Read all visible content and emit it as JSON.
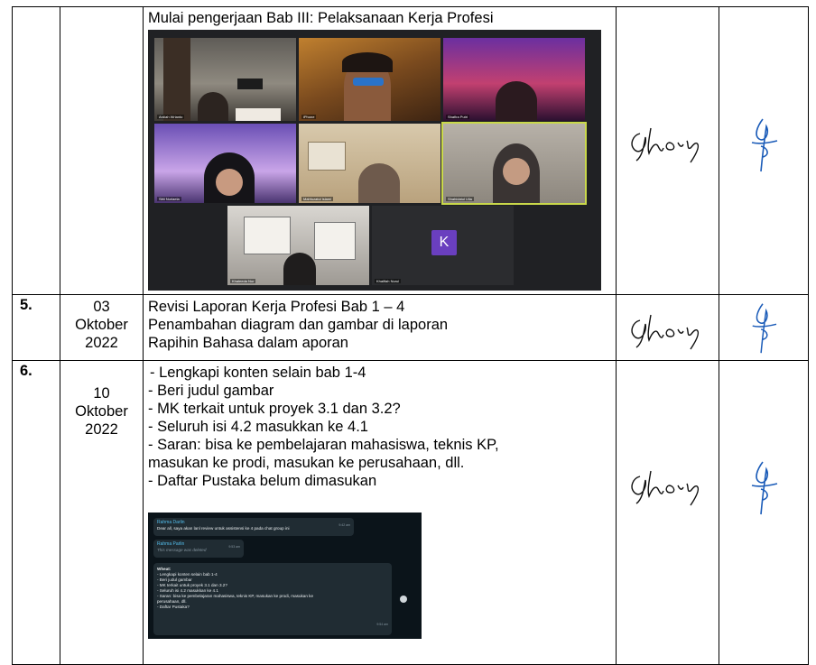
{
  "row4": {
    "activity": "Mulai pengerjaan Bab III: Pelaksanaan Kerja Profesi",
    "meeting": {
      "participants": [
        "Ardiah Wrianto",
        "iPhone",
        "Shafira Putri",
        "Sitti Nurlaela",
        "Mahfuzatul Islami",
        "Shahidatul Ulla",
        "Khaleeda Nur",
        "Khalifah Nurul"
      ],
      "avatar_letter": "K"
    }
  },
  "row5": {
    "no": "5.",
    "date": [
      "03",
      "Oktober",
      "2022"
    ],
    "lines": [
      "Revisi Laporan Kerja Profesi Bab 1 – 4",
      "Penambahan diagram dan gambar di laporan",
      "Rapihin Bahasa dalam aporan"
    ]
  },
  "row6": {
    "no": "6.",
    "date": [
      "10",
      "Oktober",
      "2022"
    ],
    "lines": [
      " - Lengkapi  konten selain bab 1-4",
      "- Beri judul gambar",
      "- MK terkait untuk proyek 3.1 dan 3.2?",
      "- Seluruh isi 4.2 masukkan ke 4.1",
      "- Saran: bisa ke pembelajaran mahasiswa, teknis KP,",
      "masukan ke prodi, masukan ke perusahaan, dll.",
      "- Daftar Pustaka belum dimasukan"
    ],
    "chat": {
      "msg1_name": "Rahma Darlin",
      "msg1_text": "Dear all, saya akan lanl review untuk assistensi ke 4 pada chat group ini",
      "msg1_time": "9:42 am",
      "msg2_name": "Rahma Parlin",
      "msg2_text": "This message was deleted",
      "msg2_time": "9:53 am",
      "msg3_lines": [
        "Wheat:",
        "- Lengkapi  konten selain bab 1-4",
        "- Beri judul gambar",
        "- MK terkait untuk proyek 3.1 dan 3.2?",
        "- Seluruh isi 4.2 masukkan ke 4.1",
        "- Saran: bisa ke pembelajaran mahasiswa, teknis KP, masukan ke prodi, masukan ke",
        "perusahaan, dll.",
        "- Daftar Pustaka?"
      ],
      "msg3_time": "9:54 am"
    }
  },
  "colors": {
    "ink": "#000000",
    "signature_blue": "#1a5bb8",
    "zoom_bg": "#202124",
    "chat_bg": "#0b141a"
  }
}
